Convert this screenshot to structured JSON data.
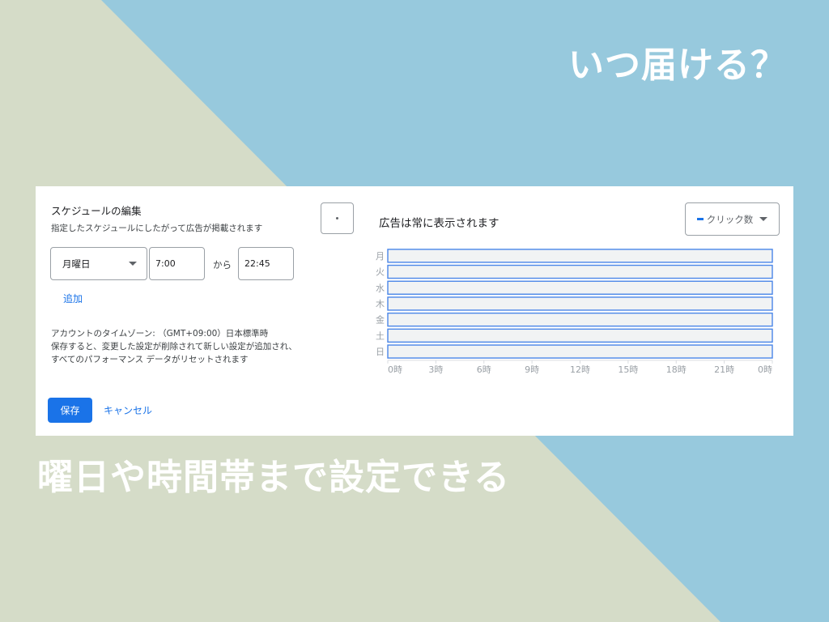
{
  "headline_top": "いつ届ける？",
  "headline_bottom": "曜日や時間帯まで設定できる",
  "colors": {
    "background_left": "#d5dcc8",
    "background_right": "#97c9dd",
    "accent": "#1a73e8",
    "bar_fill": "#f1f3f4",
    "bar_stroke": "#4a86e8"
  },
  "editor": {
    "title": "スケジュールの編集",
    "subtitle": "指定したスケジュールにしたがって広告が掲載されます",
    "more_icon": "more-vert-icon",
    "day_select": {
      "value": "月曜日"
    },
    "time_from": "7:00",
    "separator": "から",
    "time_to": "22:45",
    "add_label": "追加",
    "timezone_note": "アカウントのタイムゾーン: （GMT+09:00）日本標準時",
    "warning_line1": "保存すると、変更した設定が削除されて新しい設定が追加され、",
    "warning_line2": "すべてのパフォーマンス データがリセットされます",
    "save_label": "保存",
    "cancel_label": "キャンセル"
  },
  "schedule_view": {
    "title": "広告は常に表示されます",
    "metric_dropdown": "クリック数"
  },
  "chart_data": {
    "type": "bar",
    "orientation": "horizontal",
    "categories": [
      "月",
      "火",
      "水",
      "木",
      "金",
      "土",
      "日"
    ],
    "x_ticks": [
      "0時",
      "3時",
      "6時",
      "9時",
      "12時",
      "15時",
      "18時",
      "21時",
      "0時"
    ],
    "xlim": [
      0,
      24
    ],
    "series": [
      {
        "values": [
          [
            0,
            24
          ],
          [
            0,
            24
          ],
          [
            0,
            24
          ],
          [
            0,
            24
          ],
          [
            0,
            24
          ],
          [
            0,
            24
          ],
          [
            0,
            24
          ]
        ]
      }
    ]
  }
}
